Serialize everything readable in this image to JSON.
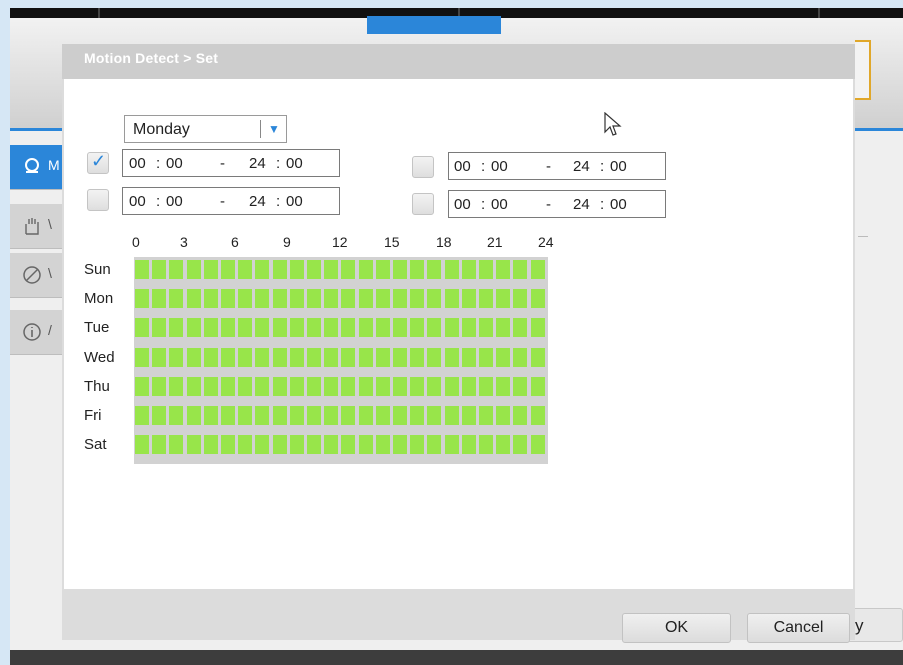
{
  "background": {
    "side_tabs": [
      {
        "icon": "motion-icon",
        "label": "M",
        "active": true
      },
      {
        "icon": "hand-icon",
        "label": "\\",
        "active": false
      },
      {
        "icon": "blocked-icon",
        "label": "\\",
        "active": false
      },
      {
        "icon": "info-icon",
        "label": "/",
        "active": false
      }
    ],
    "right_button_label": "y"
  },
  "dialog": {
    "title": "Motion Detect > Set",
    "day_select": {
      "value": "Monday",
      "arrow": "▼"
    },
    "periods": [
      {
        "checked": true,
        "start_h": "00",
        "start_m": "00",
        "dash": "-",
        "end_h": "24",
        "end_m": "00"
      },
      {
        "checked": false,
        "start_h": "00",
        "start_m": "00",
        "dash": "-",
        "end_h": "24",
        "end_m": "00"
      },
      {
        "checked": false,
        "start_h": "00",
        "start_m": "00",
        "dash": "-",
        "end_h": "24",
        "end_m": "00"
      },
      {
        "checked": false,
        "start_h": "00",
        "start_m": "00",
        "dash": "-",
        "end_h": "24",
        "end_m": "00"
      }
    ],
    "time_sep": ":",
    "hour_labels": [
      "0",
      "3",
      "6",
      "9",
      "12",
      "15",
      "18",
      "21",
      "24"
    ],
    "days": [
      "Sun",
      "Mon",
      "Tue",
      "Wed",
      "Thu",
      "Fri",
      "Sat"
    ],
    "schedule_slots_per_day": 24,
    "slot_active_color": "#98e54a",
    "ok_label": "OK",
    "cancel_label": "Cancel"
  },
  "colors": {
    "accent": "#2b86d9",
    "schedule_on": "#98e54a",
    "dialog_title": "#ffffff"
  }
}
